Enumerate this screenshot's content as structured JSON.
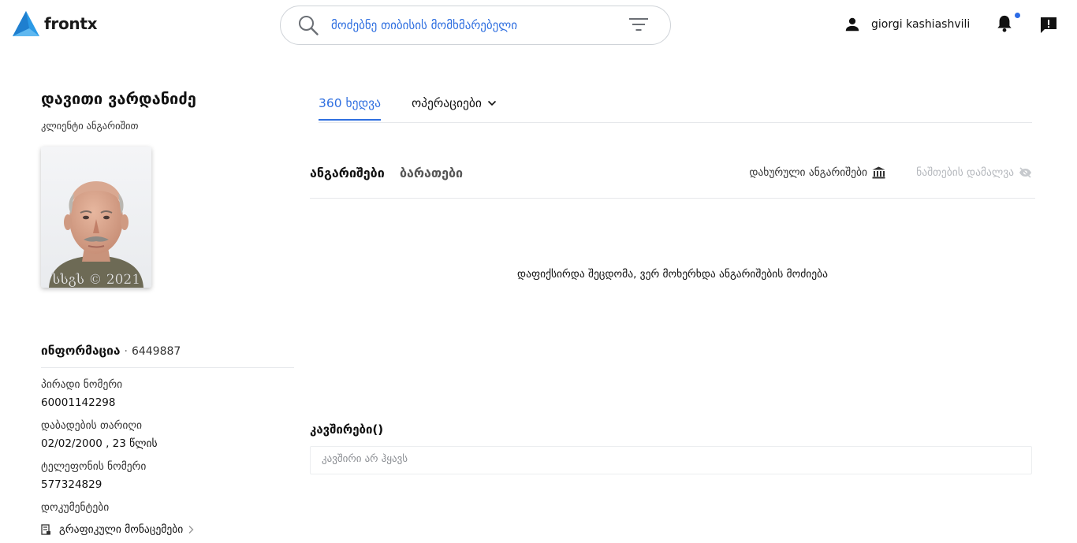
{
  "header": {
    "brand": "frontx",
    "search": {
      "value": "მოძებნე თიბისის მომხმარებელი"
    },
    "user_name": "giorgi kashiashvili"
  },
  "client": {
    "name": "დავითი ვარდანიძე",
    "subtitle": "კლიენტი ანგარიშით",
    "photo_watermark": "სსგს © 2021"
  },
  "info": {
    "title": "ინფორმაცია",
    "separator": "·",
    "id": "6449887",
    "fields": [
      {
        "label": "პირადი ნომერი",
        "value": "60001142298"
      },
      {
        "label": "დაბადების თარიღი",
        "value": "02/02/2000 , 23 წლის"
      },
      {
        "label": "ტელეფონის ნომერი",
        "value": "577324829"
      },
      {
        "label": "დოკუმენტები"
      }
    ],
    "docs_link": "გრაფიკული მონაცემები"
  },
  "main_tabs": {
    "view360": "360 ხედვა",
    "operations": "ოპერაციები"
  },
  "accounts": {
    "tab_accounts": "ანგარიშები",
    "tab_cards": "ბარათები",
    "closed_accounts": "დახურული ანგარიშები",
    "hide_balances": "ნაშთების დამალვა",
    "error": "დაფიქსირდა შეცდომა, ვერ მოხერხდა ანგარიშების მოძიება"
  },
  "relations": {
    "title": "კავშირები()",
    "empty": "კავშირი არ ჰყავს"
  },
  "colors": {
    "accent": "#2f6fe0",
    "logo": "#2b9ae6",
    "notification_dot": "#2b6be6",
    "muted": "#b5b8bd"
  },
  "icons": [
    "logo-mark",
    "search-icon",
    "filter-icon",
    "person-icon",
    "bell-icon",
    "chat-alert-icon",
    "chevron-down-icon",
    "bank-icon",
    "eye-off-icon",
    "document-icon",
    "chevron-right-icon"
  ]
}
